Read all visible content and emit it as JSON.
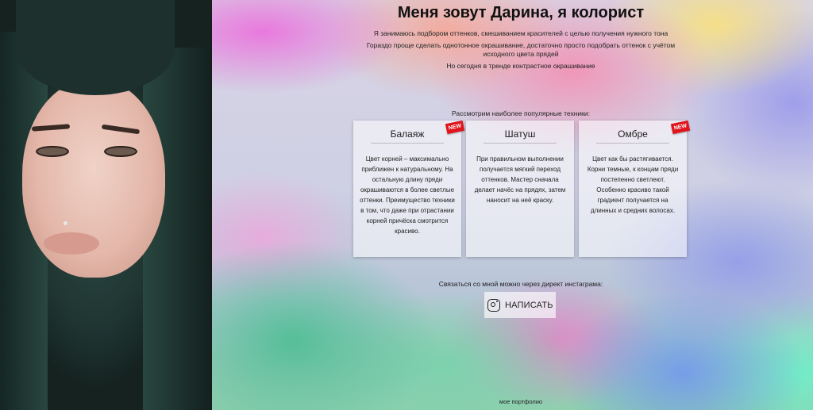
{
  "header": {
    "title": "Меня зовут Дарина, я колорист"
  },
  "intro": {
    "lines": [
      "Я занимаюсь подбором оттенков, смешиванием красителей с целью получения нужного тона",
      "Гораздо проще сделать однотонное окрашивание, достаточно просто подобрать оттенок с учётом исходного цвета прядей",
      "Но сегодня в тренде контрастное окрашивание"
    ]
  },
  "techniques": {
    "heading": "Рассмотрим наиболее популярные техники:",
    "cards": [
      {
        "title": "Балаяж",
        "badge": "NEW",
        "text": "Цвет корней – максимально приближен к натуральному. На остальную длину пряди окрашиваются в более светлые оттенки. Преимущество техники в том, что даже при отрастании корней причёска смотрится красиво."
      },
      {
        "title": "Шатуш",
        "badge": "",
        "text": "При правильном выполнении получается мягкий переход оттенков. Мастер сначала делает начёс на прядях, затем наносит на неё краску."
      },
      {
        "title": "Омбре",
        "badge": "NEW",
        "text": "Цвет как бы растягивается. Корни темные, к концам пряди постепенно светлеют. Особенно красиво такой градиент получается на длинных и средних волосах."
      }
    ]
  },
  "contact": {
    "text": "Связаться со мной можно через директ инстаграма:",
    "button_label": "НАПИСАТЬ",
    "button_icon": "instagram-icon"
  },
  "footer": {
    "portfolio_link": "мое портфолио"
  },
  "colors": {
    "badge": "#e0141c",
    "card_bg": "rgba(255,255,255,0.55)"
  }
}
